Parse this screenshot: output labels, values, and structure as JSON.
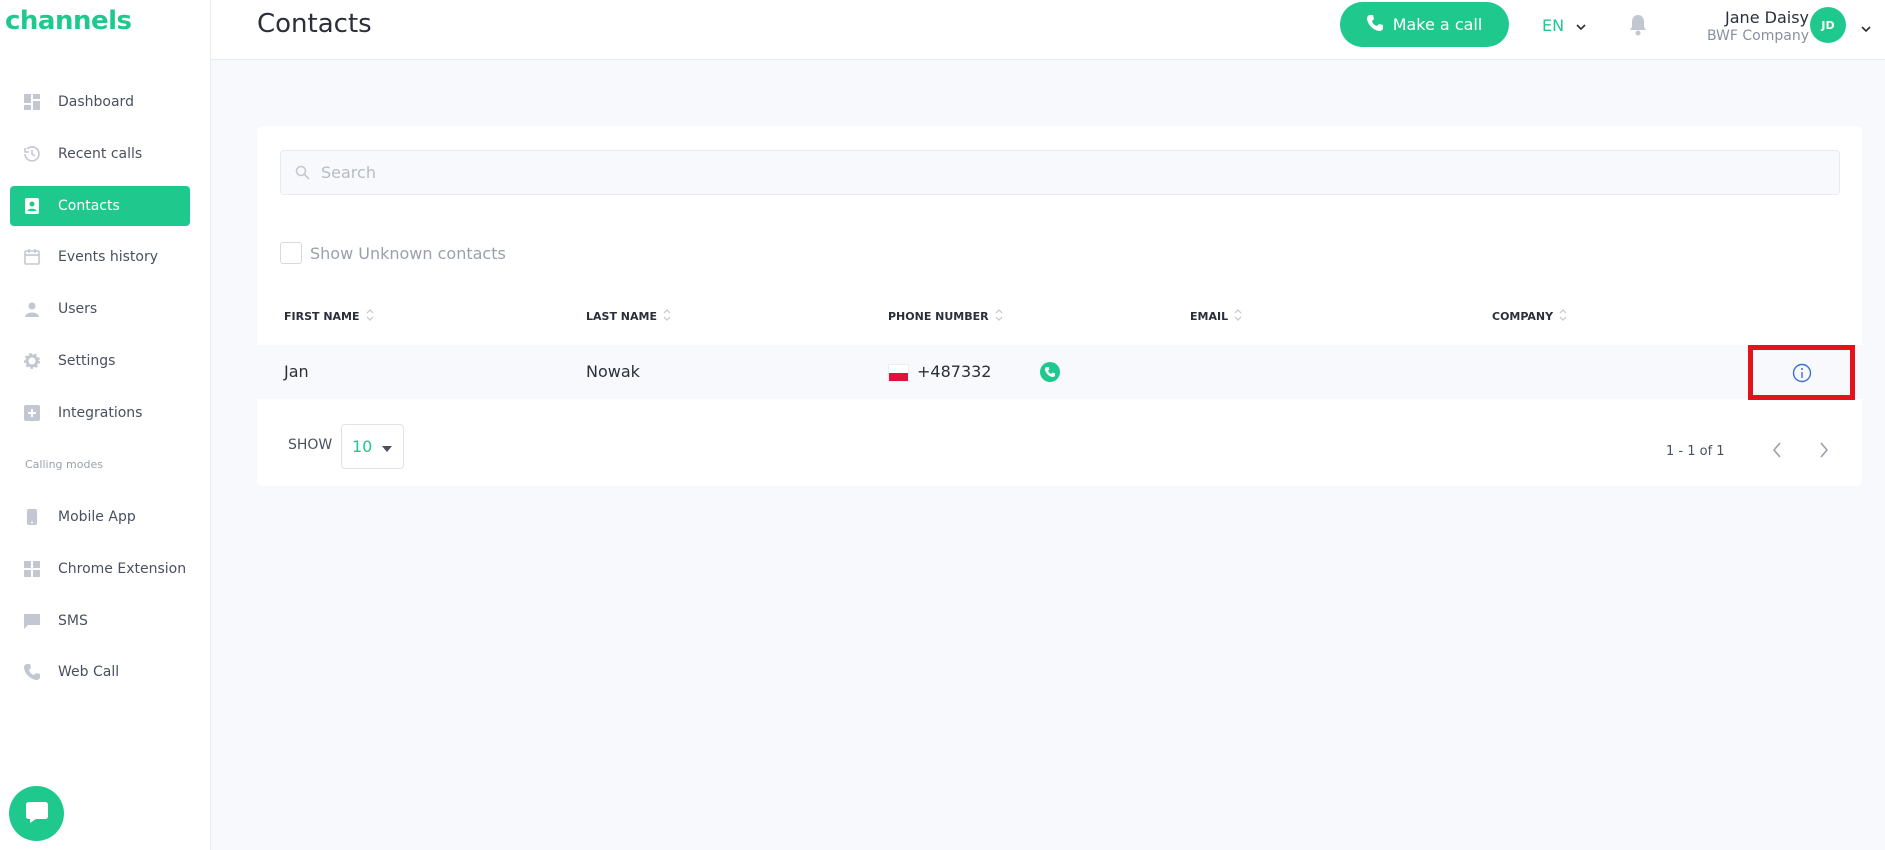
{
  "sidebar": {
    "logo": "channels",
    "items": [
      {
        "label": "Dashboard",
        "icon": "dashboard-icon"
      },
      {
        "label": "Recent calls",
        "icon": "history-icon"
      },
      {
        "label": "Contacts",
        "icon": "contacts-icon",
        "active": true
      },
      {
        "label": "Events history",
        "icon": "calendar-icon"
      },
      {
        "label": "Users",
        "icon": "user-icon"
      },
      {
        "label": "Settings",
        "icon": "gear-icon"
      },
      {
        "label": "Integrations",
        "icon": "plus-box-icon"
      }
    ],
    "section_label": "Calling modes",
    "mode_items": [
      {
        "label": "Mobile App",
        "icon": "phone-device-icon"
      },
      {
        "label": "Chrome Extension",
        "icon": "extension-icon"
      },
      {
        "label": "SMS",
        "icon": "chat-icon"
      },
      {
        "label": "Web Call",
        "icon": "phone-icon"
      }
    ]
  },
  "header": {
    "title": "Contacts",
    "make_call_label": "Make a call",
    "language": "EN",
    "user": {
      "name": "Jane Daisy",
      "company": "BWF Company",
      "initials": "JD"
    }
  },
  "search": {
    "placeholder": "Search",
    "value": ""
  },
  "filters": {
    "unknown_contacts_label": "Show Unknown contacts",
    "unknown_contacts_checked": false
  },
  "table": {
    "columns": [
      "FIRST NAME",
      "LAST NAME",
      "PHONE NUMBER",
      "EMAIL",
      "COMPANY"
    ],
    "rows": [
      {
        "first_name": "Jan",
        "last_name": "Nowak",
        "phone": "+487332",
        "email": "",
        "company": "",
        "flag": "poland-flag"
      }
    ]
  },
  "pagination": {
    "show_label": "SHOW",
    "page_size": "10",
    "range": "1 - 1 of 1"
  },
  "colors": {
    "accent": "#1fc98e",
    "highlight": "#e3121b",
    "info": "#3d6fd6"
  }
}
